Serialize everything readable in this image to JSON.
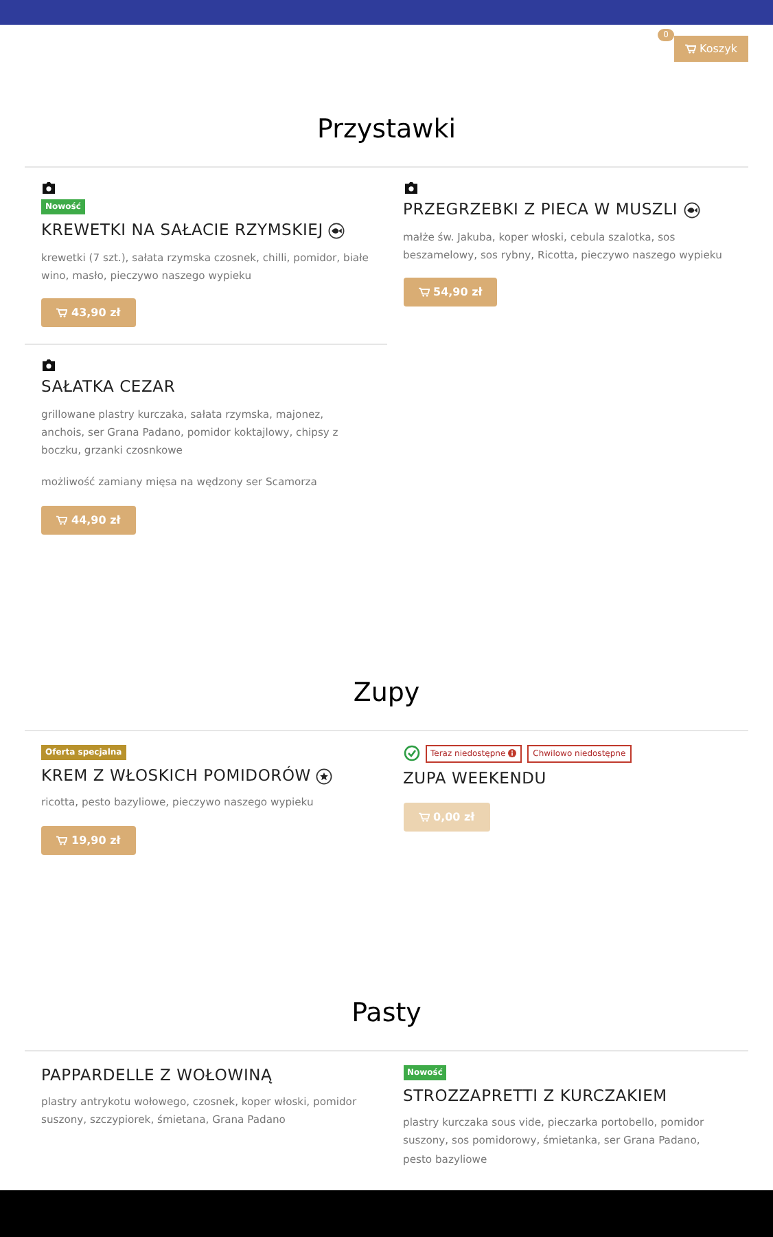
{
  "cart": {
    "label": "Koszyk",
    "count": "0"
  },
  "sections": [
    {
      "title": "Przystawki",
      "items": [
        {
          "photo": true,
          "available_check": false,
          "badges": [
            {
              "text": "Nowość",
              "kind": "new"
            }
          ],
          "name": "KREWETKI NA SAŁACIE RZYMSKIEJ",
          "symbol": {
            "kind": "fish"
          },
          "description": "krewetki (7 szt.), sałata rzymska czosnek, chilli, pomidor, białe wino, masło, pieczywo naszego wypieku",
          "price": "43,90 zł",
          "disabled": false
        },
        {
          "photo": true,
          "available_check": false,
          "name": "PRZEGRZEBKI Z PIECA W MUSZLI",
          "symbol": {
            "kind": "fish"
          },
          "description": "małże św. Jakuba, koper włoski, cebula szalotka, sos beszamelowy, sos rybny, Ricotta, pieczywo naszego wypieku",
          "price": "54,90 zł",
          "disabled": false
        },
        {
          "photo": true,
          "available_check": false,
          "name": "SAŁATKA CEZAR",
          "description": "grillowane plastry kurczaka, sałata rzymska, majonez, anchois, ser Grana Padano, pomidor koktajlowy, chipsy z boczku, grzanki czosnkowe",
          "note": "możliwość zamiany mięsa na wędzony ser Scamorza",
          "price": "44,90 zł",
          "disabled": false
        }
      ]
    },
    {
      "title": "Zupy",
      "items": [
        {
          "photo": false,
          "available_check": false,
          "badges": [
            {
              "text": "Oferta specjalna",
              "kind": "special"
            }
          ],
          "name": "KREM Z WŁOSKICH POMIDORÓW",
          "symbol": {
            "kind": "star"
          },
          "description": "ricotta, pesto bazyliowe, pieczywo naszego wypieku",
          "price": "19,90 zł",
          "disabled": false
        },
        {
          "photo": false,
          "available_check": true,
          "badges": [
            {
              "text": "Teraz niedostępne",
              "kind": "unavailable",
              "info": true
            },
            {
              "text": "Chwilowo niedostępne",
              "kind": "unavailable",
              "info": false
            }
          ],
          "name": "ZUPA WEEKENDU",
          "price": "0,00 zł",
          "disabled": true
        }
      ]
    },
    {
      "title": "Pasty",
      "items": [
        {
          "photo": false,
          "available_check": false,
          "name": "PAPPARDELLE Z WOŁOWINĄ",
          "description": "plastry antrykotu wołowego, czosnek, koper włoski, pomidor suszony, szczypiorek, śmietana, Grana Padano"
        },
        {
          "photo": false,
          "available_check": false,
          "badges": [
            {
              "text": "Nowość",
              "kind": "new"
            }
          ],
          "name": "STROZZAPRETTI Z KURCZAKIEM",
          "description": "plastry kurczaka sous vide, pieczarka portobello, pomidor suszony, sos pomidorowy, śmietanka, ser Grana Padano, pesto bazyliowe"
        }
      ]
    }
  ]
}
